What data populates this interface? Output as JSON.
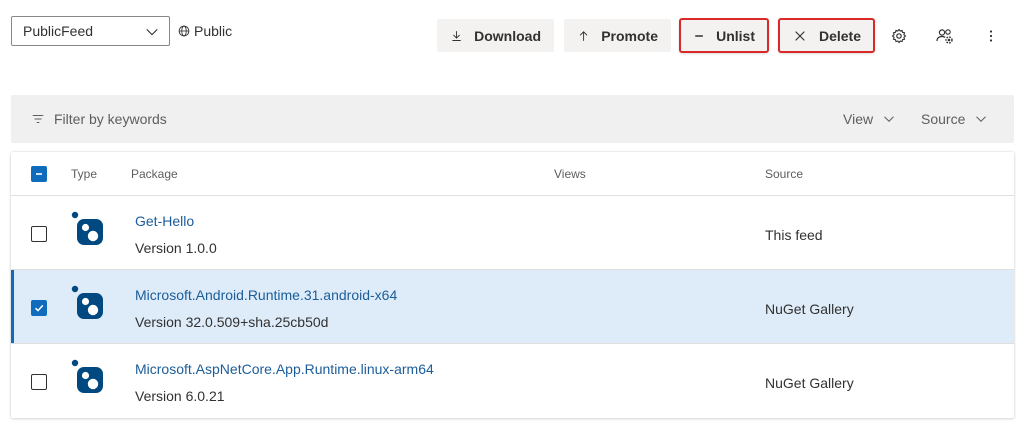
{
  "header": {
    "feed_select": {
      "value": "PublicFeed",
      "icon": "chevron-down-icon"
    },
    "visibility": {
      "label": "Public",
      "icon": "globe-icon"
    },
    "actions": {
      "download": "Download",
      "promote": "Promote",
      "unlist": "Unlist",
      "delete": "Delete"
    },
    "icons": [
      "gear-icon",
      "people-settings-icon",
      "more-vertical-icon"
    ]
  },
  "filter": {
    "placeholder": "Filter by keywords",
    "view_label": "View",
    "source_label": "Source"
  },
  "table": {
    "columns": {
      "type": "Type",
      "package": "Package",
      "views": "Views",
      "source": "Source"
    },
    "rows": [
      {
        "name": "Get-Hello",
        "version": "Version 1.0.0",
        "source": "This feed",
        "selected": false
      },
      {
        "name": "Microsoft.Android.Runtime.31.android-x64",
        "version": "Version 32.0.509+sha.25cb50d",
        "source": "NuGet Gallery",
        "selected": true
      },
      {
        "name": "Microsoft.AspNetCore.App.Runtime.linux-arm64",
        "version": "Version 6.0.21",
        "source": "NuGet Gallery",
        "selected": false
      }
    ]
  },
  "colors": {
    "accent": "#0f6cbd",
    "selected_row": "#deecf9",
    "highlight_outline": "#d92929",
    "link": "#1c5d99",
    "nuget_icon": "#004880"
  }
}
